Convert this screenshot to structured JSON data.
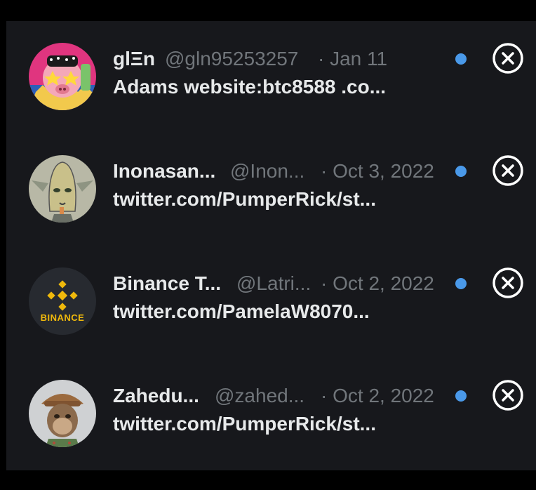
{
  "colors": {
    "unread_dot": "#4a99e9",
    "panel_bg": "#17181c",
    "text_primary": "#e7e9ea",
    "text_secondary": "#71767b"
  },
  "messages": [
    {
      "name": "glΞn",
      "handle": "@gln95253257",
      "date": "· Jan 11",
      "snippet": "Adams website:btc8588 .co...",
      "unread": true,
      "avatar": "cartoon-pig-avatar"
    },
    {
      "name": "Inonasan...",
      "handle": "@Inon...",
      "date": "· Oct 3, 2022",
      "snippet": "twitter.com/PumperRick/st...",
      "unread": true,
      "avatar": "goblin-avatar"
    },
    {
      "name": "Binance T...",
      "handle": "@Latri...",
      "date": "· Oct 2, 2022",
      "snippet": "twitter.com/PamelaW8070...",
      "unread": true,
      "avatar": "binance-logo-avatar",
      "avatar_text": "BINANCE"
    },
    {
      "name": "Zahedu...",
      "handle": "@zahed...",
      "date": "· Oct 2, 2022",
      "snippet": "twitter.com/PumperRick/st...",
      "unread": true,
      "avatar": "ape-avatar"
    }
  ]
}
